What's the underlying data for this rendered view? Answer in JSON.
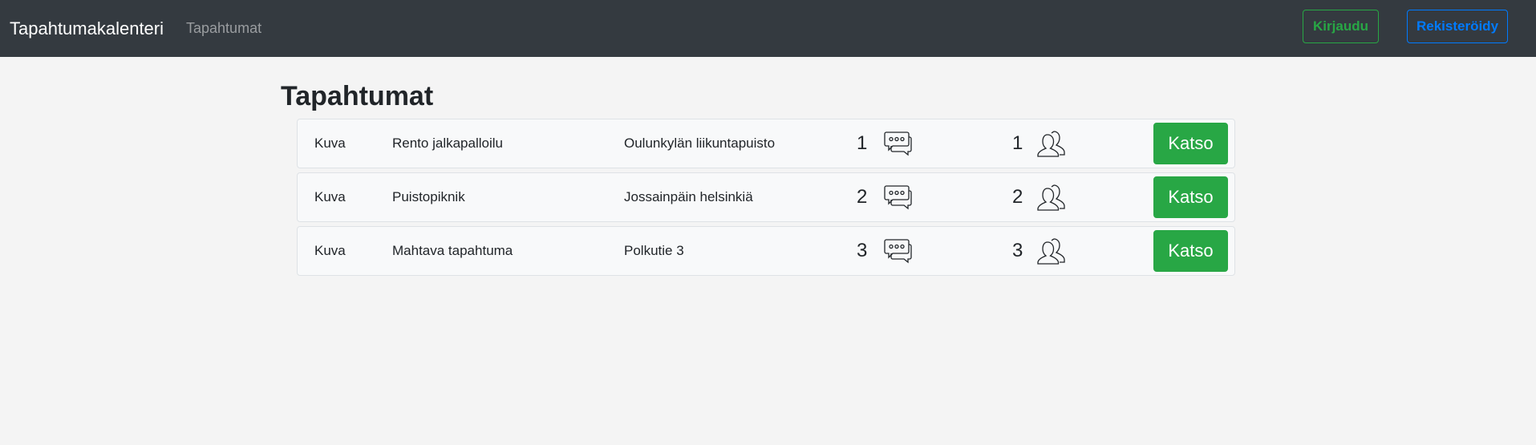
{
  "navbar": {
    "brand": "Tapahtumakalenteri",
    "link": "Tapahtumat",
    "login_label": "Kirjaudu",
    "register_label": "Rekisteröidy"
  },
  "main": {
    "title": "Tapahtumat",
    "events": [
      {
        "image_label": "Kuva",
        "name": "Rento jalkapalloilu",
        "location": "Oulunkylän liikuntapuisto",
        "comments": "1",
        "participants": "1",
        "view_label": "Katso"
      },
      {
        "image_label": "Kuva",
        "name": "Puistopiknik",
        "location": "Jossainpäin helsinkiä",
        "comments": "2",
        "participants": "2",
        "view_label": "Katso"
      },
      {
        "image_label": "Kuva",
        "name": "Mahtava tapahtuma",
        "location": "Polkutie 3",
        "comments": "3",
        "participants": "3",
        "view_label": "Katso"
      }
    ]
  },
  "icons": {
    "comments": "chat-bubbles-icon",
    "participants": "people-icon"
  },
  "colors": {
    "navbar_bg": "#343a40",
    "success": "#28a745",
    "primary": "#007bff",
    "page_bg": "#f4f4f4"
  }
}
